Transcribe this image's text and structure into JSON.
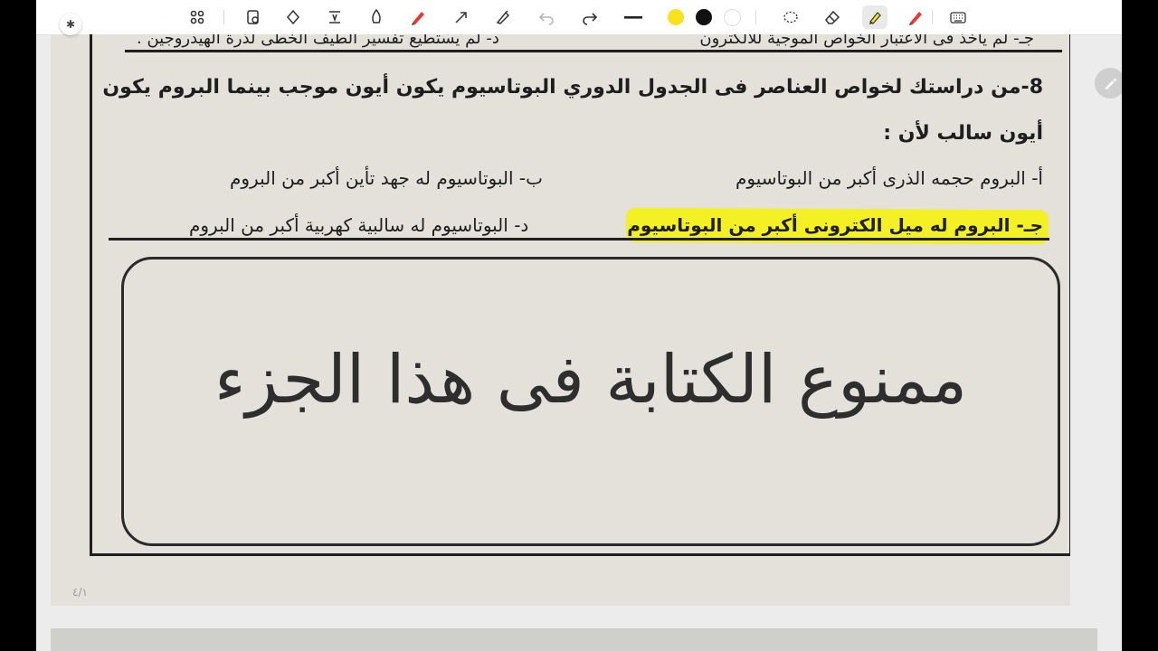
{
  "toolbar": {
    "tools": [
      {
        "name": "grid-icon"
      },
      {
        "name": "lasso-shapes-icon"
      },
      {
        "name": "shapes-icon"
      },
      {
        "name": "text-tool-icon"
      },
      {
        "name": "highlighter-fine-icon"
      },
      {
        "name": "pen-red-icon"
      },
      {
        "name": "arrow-pen-icon"
      },
      {
        "name": "pen-feather-icon"
      },
      {
        "name": "undo-icon"
      },
      {
        "name": "redo-icon"
      },
      {
        "name": "stroke-width-icon"
      },
      {
        "name": "eraser-icon"
      },
      {
        "name": "marker-yellow-icon"
      },
      {
        "name": "pen-marker-red-icon"
      },
      {
        "name": "keyboard-icon"
      }
    ],
    "colors": {
      "yellow": "#f7e21b",
      "black": "#111111",
      "white": "#ffffff"
    }
  },
  "document": {
    "top_partial_right": "جـ- لم يأخذ فى الاعتبار الخواص الموجية للالكترون",
    "top_partial_left": "د- لم يستطيع تفسير الطيف الخطى لذرة الهيدروجين .",
    "question_line1": "8-من دراستك لخواص العناصر فى الجدول الدوري البوتاسيوم يكون أيون موجب بينما البروم يكون",
    "question_line2": "أيون سالب لأن :",
    "option_a": "أ- البروم حجمه الذرى أكبر من البوتاسيوم",
    "option_b": "ب- البوتاسيوم له جهد تأين أكبر من البروم",
    "option_c": "جـ- البروم له ميل الكترونى أكبر من البوتاسيوم",
    "option_d": "د- البوتاسيوم له سالبية كهربية أكبر من البروم",
    "forbidden_notice": "ممنوع الكتابة فى هذا الجزء",
    "page_number": "٤/١"
  },
  "highlight_color": "#f3f019"
}
